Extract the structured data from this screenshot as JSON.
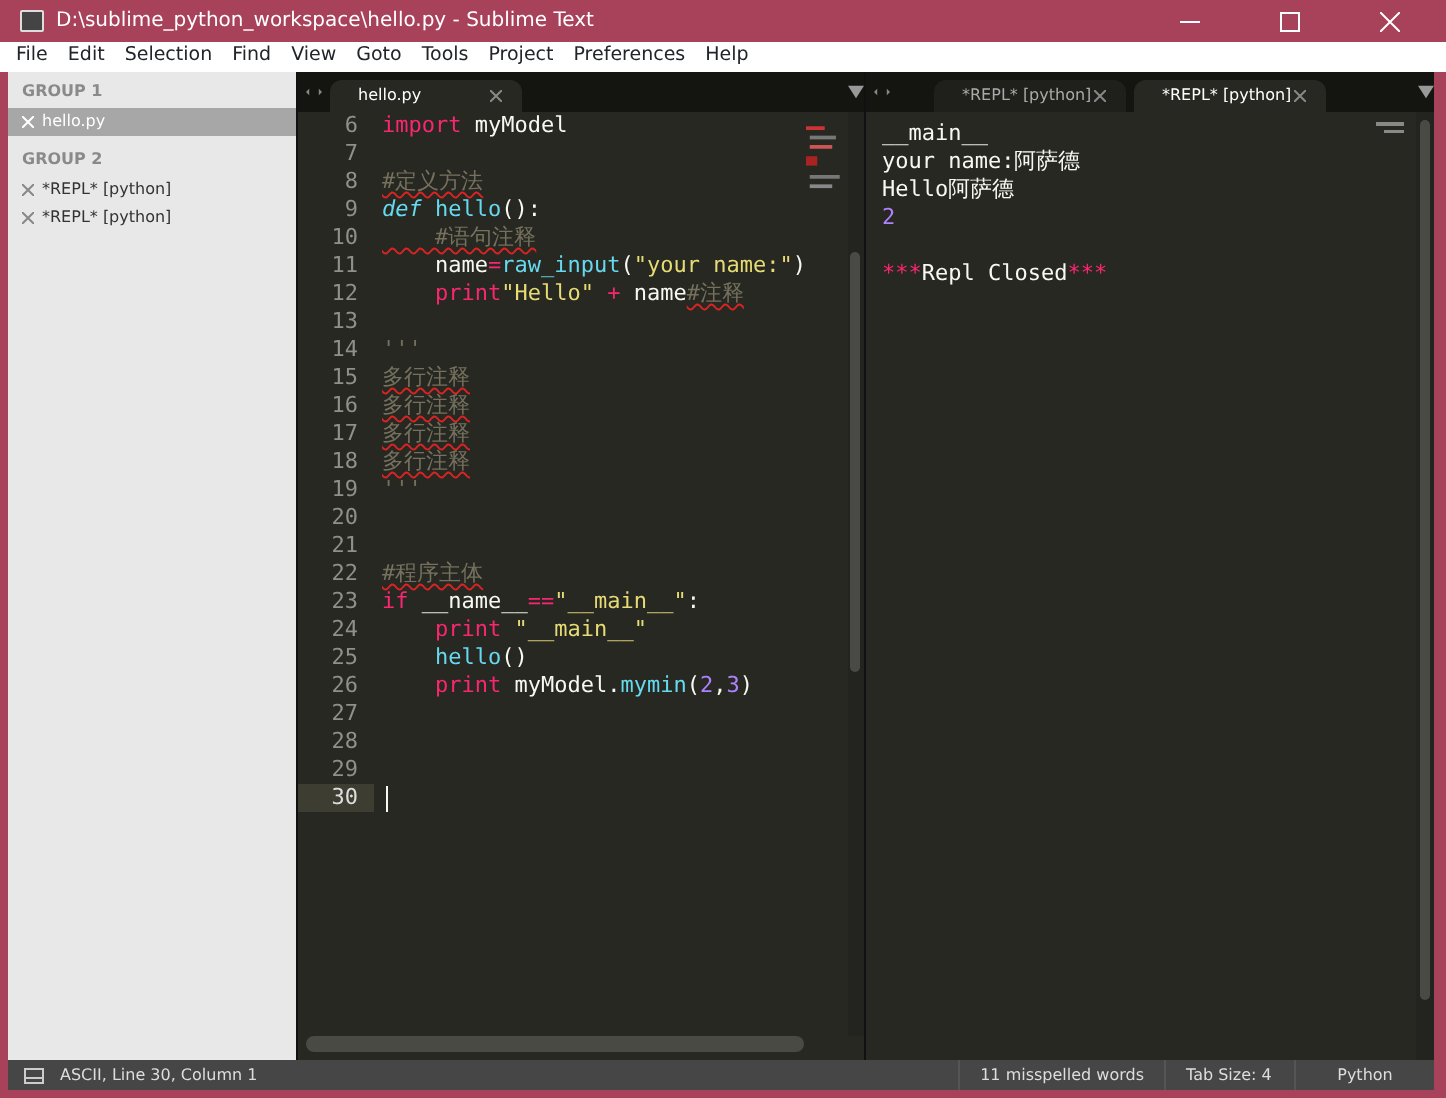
{
  "window": {
    "title": "D:\\sublime_python_workspace\\hello.py - Sublime Text"
  },
  "menu": [
    "File",
    "Edit",
    "Selection",
    "Find",
    "View",
    "Goto",
    "Tools",
    "Project",
    "Preferences",
    "Help"
  ],
  "sidebar": {
    "groups": [
      {
        "label": "GROUP 1",
        "files": [
          {
            "name": "hello.py",
            "selected": true
          }
        ]
      },
      {
        "label": "GROUP 2",
        "files": [
          {
            "name": "*REPL* [python]",
            "selected": false
          },
          {
            "name": "*REPL* [python]",
            "selected": false
          }
        ]
      }
    ]
  },
  "editors": [
    {
      "tabs": [
        {
          "label": "hello.py",
          "selected": true
        }
      ],
      "lines": [
        {
          "number": "6",
          "current": false,
          "tokens": [
            {
              "kind": "keyword",
              "text": "import"
            },
            {
              "kind": "plain",
              "text": " myModel"
            }
          ]
        },
        {
          "number": "7",
          "current": false
        },
        {
          "number": "8",
          "current": false,
          "tokens": [
            {
              "kind": "comment",
              "text": "#定义方法",
              "misspelled": true
            }
          ]
        },
        {
          "number": "9",
          "current": false,
          "tokens": [
            {
              "kind": "storage",
              "text": "def"
            },
            {
              "kind": "function",
              "text": " hello"
            },
            {
              "kind": "plain",
              "text": "():"
            }
          ]
        },
        {
          "number": "10",
          "current": false,
          "tokens": [
            {
              "kind": "comment",
              "text": "    #语句注释",
              "misspelled": true
            }
          ]
        },
        {
          "number": "11",
          "current": false,
          "tokens": [
            {
              "kind": "plain",
              "text": "    name"
            },
            {
              "kind": "operator",
              "text": "="
            },
            {
              "kind": "builtin",
              "text": "raw_input"
            },
            {
              "kind": "plain",
              "text": "("
            },
            {
              "kind": "string",
              "text": "\"your name:\""
            },
            {
              "kind": "plain",
              "text": ")"
            }
          ]
        },
        {
          "number": "12",
          "current": false,
          "tokens": [
            {
              "kind": "keyword",
              "text": "    print"
            },
            {
              "kind": "string",
              "text": "\"Hello\""
            },
            {
              "kind": "operator",
              "text": " +"
            },
            {
              "kind": "plain",
              "text": " name"
            },
            {
              "kind": "comment",
              "text": "#注释",
              "misspelled": true
            }
          ]
        },
        {
          "number": "13",
          "current": false
        },
        {
          "number": "14",
          "current": false,
          "tokens": [
            {
              "kind": "comment",
              "text": "'''"
            }
          ]
        },
        {
          "number": "15",
          "current": false,
          "tokens": [
            {
              "kind": "comment",
              "text": "多行注释",
              "misspelled": true
            }
          ]
        },
        {
          "number": "16",
          "current": false,
          "tokens": [
            {
              "kind": "comment",
              "text": "多行注释",
              "misspelled": true
            }
          ]
        },
        {
          "number": "17",
          "current": false,
          "tokens": [
            {
              "kind": "comment",
              "text": "多行注释",
              "misspelled": true
            }
          ]
        },
        {
          "number": "18",
          "current": false,
          "tokens": [
            {
              "kind": "comment",
              "text": "多行注释",
              "misspelled": true
            }
          ]
        },
        {
          "number": "19",
          "current": false,
          "tokens": [
            {
              "kind": "comment",
              "text": "'''"
            }
          ]
        },
        {
          "number": "20",
          "current": false
        },
        {
          "number": "21",
          "current": false
        },
        {
          "number": "22",
          "current": false,
          "tokens": [
            {
              "kind": "comment",
              "text": "#程序主体",
              "misspelled": true
            }
          ]
        },
        {
          "number": "23",
          "current": false,
          "tokens": [
            {
              "kind": "keyword",
              "text": "if"
            },
            {
              "kind": "plain",
              "text": " __name__"
            },
            {
              "kind": "operator",
              "text": "=="
            },
            {
              "kind": "string",
              "text": "\"__main__\""
            },
            {
              "kind": "plain",
              "text": ":"
            }
          ]
        },
        {
          "number": "24",
          "current": false,
          "tokens": [
            {
              "kind": "keyword",
              "text": "    print"
            },
            {
              "kind": "string",
              "text": " \"__main__\""
            }
          ]
        },
        {
          "number": "25",
          "current": false,
          "tokens": [
            {
              "kind": "function",
              "text": "    hello"
            },
            {
              "kind": "plain",
              "text": "()"
            }
          ]
        },
        {
          "number": "26",
          "current": false,
          "tokens": [
            {
              "kind": "keyword",
              "text": "    print"
            },
            {
              "kind": "plain",
              "text": " myModel."
            },
            {
              "kind": "function",
              "text": "mymin"
            },
            {
              "kind": "plain",
              "text": "("
            },
            {
              "kind": "number",
              "text": "2"
            },
            {
              "kind": "plain",
              "text": ","
            },
            {
              "kind": "number",
              "text": "3"
            },
            {
              "kind": "plain",
              "text": ")"
            }
          ]
        },
        {
          "number": "27",
          "current": false
        },
        {
          "number": "28",
          "current": false
        },
        {
          "number": "29",
          "current": false
        },
        {
          "number": "30",
          "current": true
        }
      ]
    },
    {
      "tabs": [
        {
          "label": "*REPL* [python]",
          "selected": false
        },
        {
          "label": "*REPL* [python]",
          "selected": true
        }
      ],
      "lines": [
        {
          "tokens": [
            {
              "kind": "plain",
              "text": "__main__"
            }
          ]
        },
        {
          "tokens": [
            {
              "kind": "plain",
              "text": "your name:阿萨德"
            }
          ]
        },
        {
          "tokens": [
            {
              "kind": "plain",
              "text": "Hello阿萨德"
            }
          ]
        },
        {
          "tokens": [
            {
              "kind": "number",
              "text": "2"
            }
          ]
        },
        {
          "spaced": true,
          "tokens": [
            {
              "kind": "keyword",
              "text": "***"
            },
            {
              "kind": "plain",
              "text": "Repl Closed"
            },
            {
              "kind": "keyword",
              "text": "***"
            }
          ]
        }
      ]
    }
  ],
  "status_bar": {
    "position": "ASCII, Line 30, Column 1",
    "spelling": "11 misspelled words",
    "tab_size": "Tab Size: 4",
    "syntax": "Python"
  }
}
